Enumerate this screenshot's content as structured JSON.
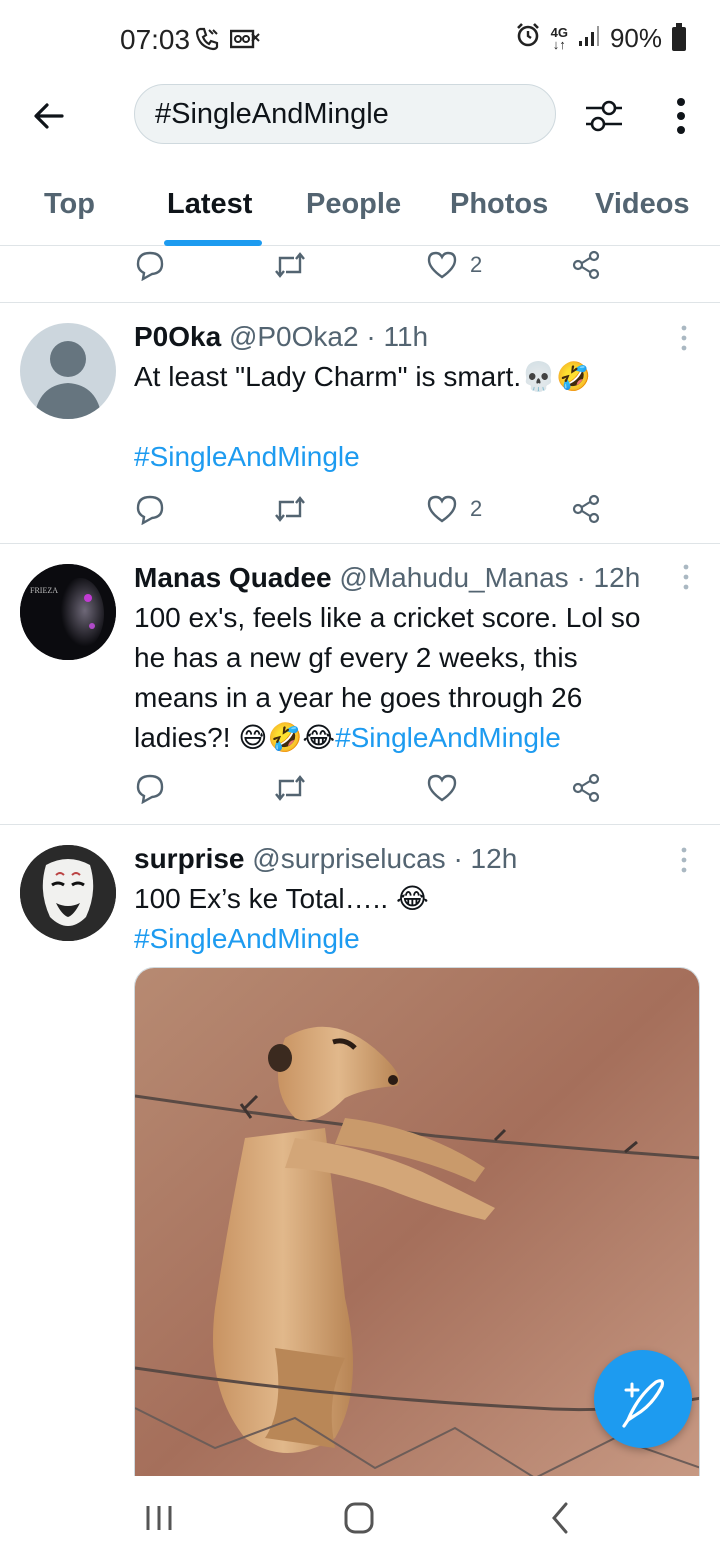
{
  "status_bar": {
    "time": "07:03",
    "icons_left": [
      "wifi-calling-icon",
      "voicemail-icon"
    ],
    "network": "4G",
    "battery": "90%",
    "icons_right": [
      "alarm-icon",
      "network-4g-icon",
      "signal-icon",
      "battery-icon"
    ]
  },
  "search": {
    "query": "#SingleAndMingle"
  },
  "tabs": [
    {
      "label": "Top"
    },
    {
      "label": "Latest",
      "active": true
    },
    {
      "label": "People"
    },
    {
      "label": "Photos"
    },
    {
      "label": "Videos"
    }
  ],
  "partial_tweet": {
    "like_count": "2"
  },
  "tweets": [
    {
      "name": "P0Oka",
      "handle": "@P0Oka2",
      "time": "11h",
      "text": "At least \"Lady Charm\" is smart.💀🤣",
      "hashtag": "#SingleAndMingle",
      "like_count": "2"
    },
    {
      "name": "Manas Quadee",
      "handle": "@Mahudu_Manas",
      "time": "12h",
      "text_lines": [
        "100 ex's, feels like a cricket score. Lol so",
        "he has a new gf every 2 weeks, this",
        "means in a year he goes through 26",
        "ladies?! 😅🤣😂"
      ],
      "hashtag": "#SingleAndMingle",
      "avatar_text": "FRIEZA",
      "like_count": ""
    },
    {
      "name": "surprise",
      "handle": "@surpriselucas",
      "time": "12h",
      "text": "100 Ex’s ke Total….. 😂",
      "hashtag": "#SingleAndMingle"
    }
  ],
  "colors": {
    "accent": "#1d9bf0",
    "secondary_text": "#536471",
    "divider": "#dfe4e7"
  }
}
